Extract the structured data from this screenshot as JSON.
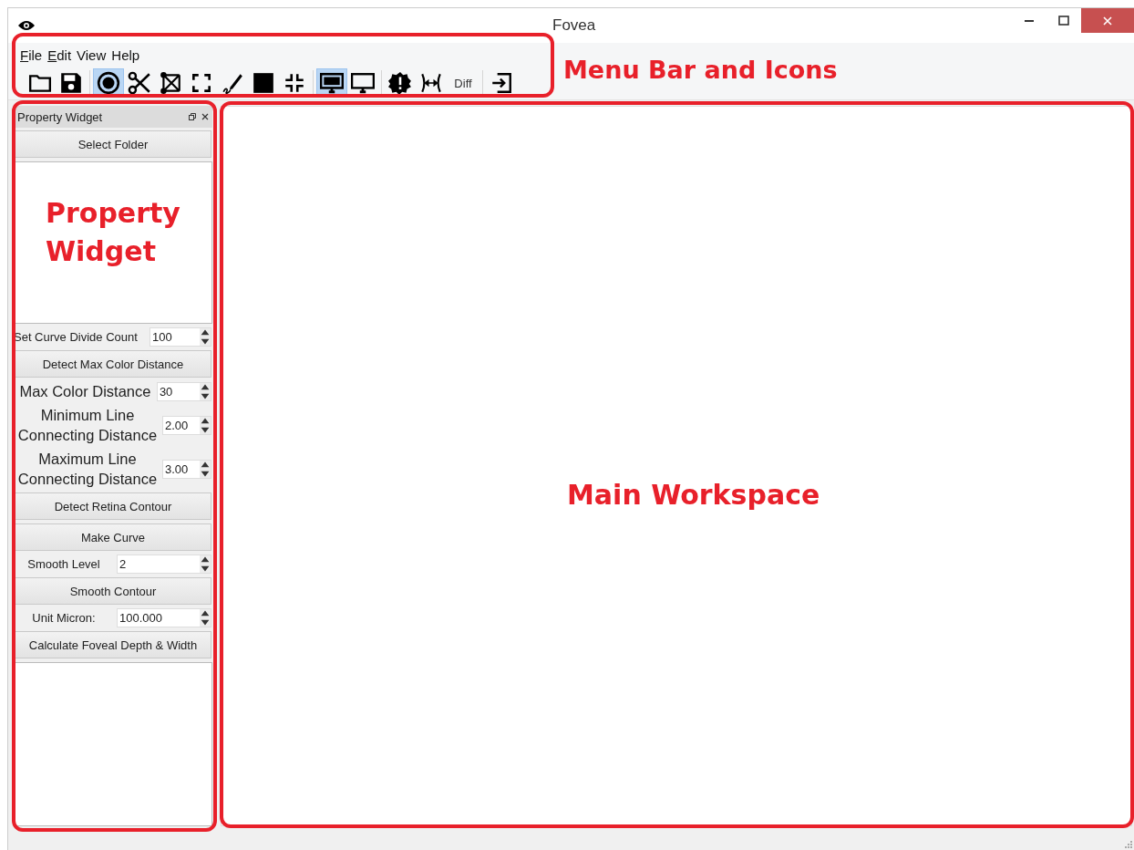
{
  "window": {
    "title": "Fovea"
  },
  "menu": [
    {
      "label": "File",
      "underline_first": true
    },
    {
      "label": "Edit",
      "underline_first": true
    },
    {
      "label": "View",
      "underline_first": false
    },
    {
      "label": "Help",
      "underline_first": false
    }
  ],
  "toolbar": [
    {
      "kind": "icon",
      "selected": false
    },
    {
      "kind": "icon",
      "selected": false
    },
    {
      "kind": "separator"
    },
    {
      "kind": "icon",
      "selected": true
    },
    {
      "kind": "icon",
      "selected": false
    },
    {
      "kind": "icon",
      "selected": false
    },
    {
      "kind": "icon",
      "selected": false
    },
    {
      "kind": "icon",
      "selected": false
    },
    {
      "kind": "icon",
      "selected": false
    },
    {
      "kind": "icon",
      "selected": false
    },
    {
      "kind": "separator"
    },
    {
      "kind": "icon",
      "selected": true
    },
    {
      "kind": "icon",
      "selected": false
    },
    {
      "kind": "separator"
    },
    {
      "kind": "icon",
      "selected": false
    },
    {
      "kind": "icon",
      "selected": false
    },
    {
      "kind": "text",
      "label": "Diff",
      "selected": false
    },
    {
      "kind": "separator"
    },
    {
      "kind": "icon",
      "selected": false
    }
  ],
  "property_widget": {
    "title": "Property Widget",
    "rows": [
      {
        "kind": "button",
        "label": "Select Folder"
      },
      {
        "kind": "list"
      },
      {
        "kind": "spin",
        "label": "Set Curve Divide Count",
        "value": "100"
      },
      {
        "kind": "button",
        "label": "Detect Max Color Distance"
      },
      {
        "kind": "spin-big",
        "label": "Max Color Distance",
        "value": "30"
      },
      {
        "kind": "spin-big",
        "label": "Minimum Line Connecting Distance",
        "value": "2.00"
      },
      {
        "kind": "spin-big",
        "label": "Maximum Line Connecting Distance",
        "value": "3.00"
      },
      {
        "kind": "button",
        "label": "Detect Retina Contour"
      },
      {
        "kind": "button",
        "label": "Make Curve"
      },
      {
        "kind": "spin-wide",
        "label": "Smooth Level",
        "value": "2"
      },
      {
        "kind": "button",
        "label": "Smooth Contour"
      },
      {
        "kind": "spin-wide",
        "label": "Unit Micron:",
        "value": "100.000"
      },
      {
        "kind": "button",
        "label": "Calculate Foveal Depth & Width"
      },
      {
        "kind": "list"
      }
    ]
  },
  "annotations": [
    {
      "label": "Menu Bar and Icons"
    },
    {
      "label": "Property Widget"
    },
    {
      "label": "Main Workspace"
    }
  ]
}
